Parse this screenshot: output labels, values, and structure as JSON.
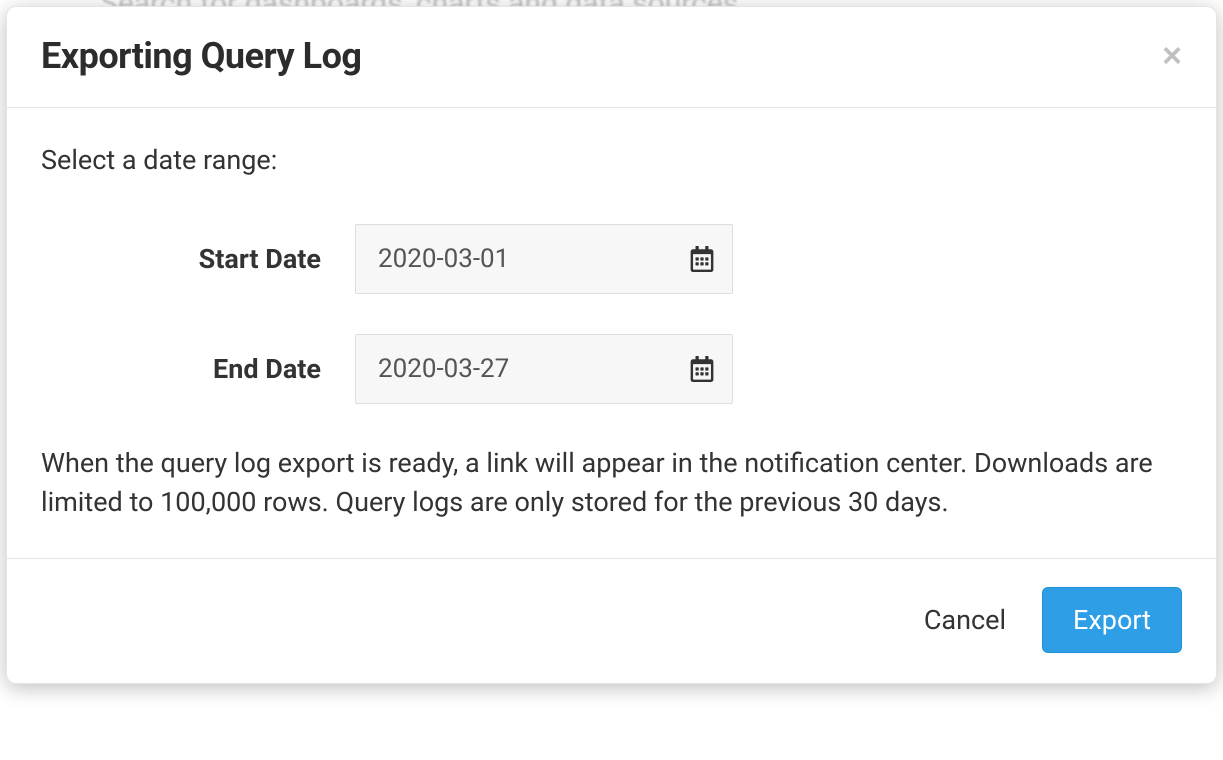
{
  "background_hint": "Search for dashboards, charts and data sources",
  "modal": {
    "title": "Exporting Query Log",
    "prompt": "Select a date range:",
    "fields": {
      "start": {
        "label": "Start Date",
        "value": "2020-03-01"
      },
      "end": {
        "label": "End Date",
        "value": "2020-03-27"
      }
    },
    "info": "When the query log export is ready, a link will appear in the notification center. Downloads are limited to 100,000 rows. Query logs are only stored for the previous 30 days.",
    "footer": {
      "cancel": "Cancel",
      "export": "Export"
    }
  }
}
